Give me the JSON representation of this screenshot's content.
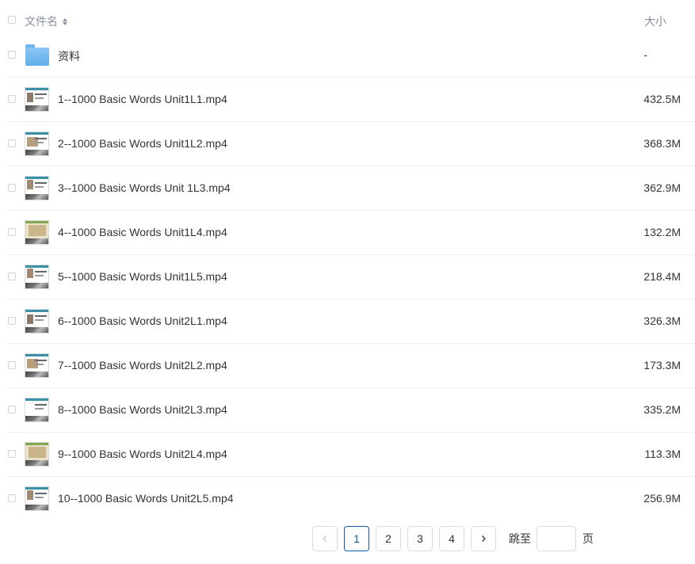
{
  "header": {
    "name_label": "文件名",
    "size_label": "大小"
  },
  "folder": {
    "name": "资料",
    "size": "-"
  },
  "files": [
    {
      "name": "1--1000 Basic Words Unit1L1.mp4",
      "size": "432.5M"
    },
    {
      "name": "2--1000 Basic Words Unit1L2.mp4",
      "size": "368.3M"
    },
    {
      "name": "3--1000 Basic Words Unit 1L3.mp4",
      "size": "362.9M"
    },
    {
      "name": "4--1000 Basic Words Unit1L4.mp4",
      "size": "132.2M"
    },
    {
      "name": "5--1000 Basic Words Unit1L5.mp4",
      "size": "218.4M"
    },
    {
      "name": "6--1000 Basic Words Unit2L1.mp4",
      "size": "326.3M"
    },
    {
      "name": "7--1000 Basic Words Unit2L2.mp4",
      "size": "173.3M"
    },
    {
      "name": "8--1000 Basic Words Unit2L3.mp4",
      "size": "335.2M"
    },
    {
      "name": "9--1000 Basic Words Unit2L4.mp4",
      "size": "113.3M"
    },
    {
      "name": "10--1000 Basic Words Unit2L5.mp4",
      "size": "256.9M"
    }
  ],
  "pagination": {
    "pages": [
      "1",
      "2",
      "3",
      "4"
    ],
    "current": "1",
    "prev_icon": "chevron-left-icon",
    "next_icon": "chevron-right-icon",
    "jump_label": "跳至",
    "jump_value": "",
    "page_suffix": "页"
  },
  "colors": {
    "accent": "#0e5ca8",
    "muted_text": "#8a8f99",
    "folder": "#6fb3ee"
  }
}
